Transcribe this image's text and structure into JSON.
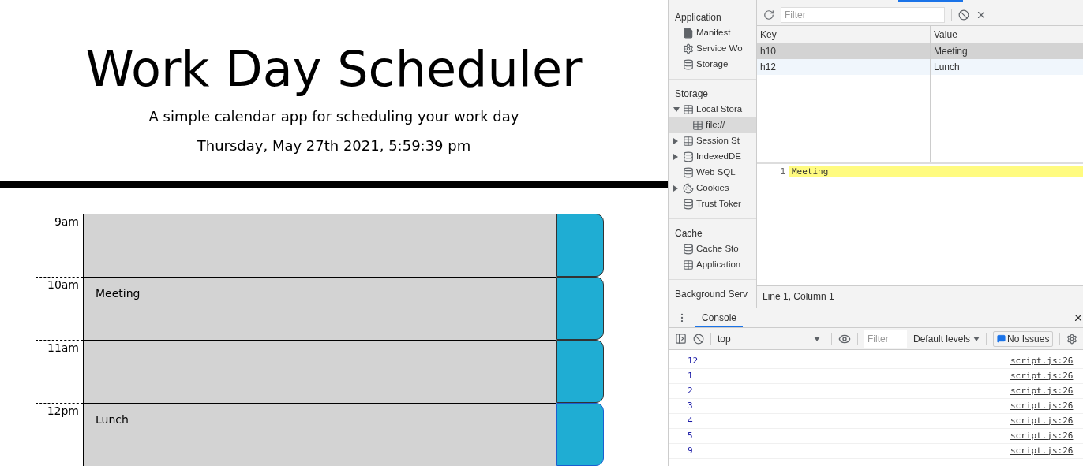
{
  "app": {
    "title": "Work Day Scheduler",
    "subtitle": "A simple calendar app for scheduling your work day",
    "date": "Thursday, May 27th 2021, 5:59:39 pm",
    "rows": [
      {
        "hour": "9am",
        "text": "",
        "focused": false
      },
      {
        "hour": "10am",
        "text": "Meeting",
        "focused": false
      },
      {
        "hour": "11am",
        "text": "",
        "focused": false
      },
      {
        "hour": "12pm",
        "text": "Lunch",
        "focused": true
      }
    ]
  },
  "devtools": {
    "sidebar": [
      {
        "heading": "Application",
        "items": [
          {
            "label": "Manifest",
            "kind": "file",
            "selected": false
          },
          {
            "label": "Service Wo",
            "kind": "gear",
            "selected": false
          },
          {
            "label": "Storage",
            "kind": "db",
            "selected": false
          }
        ]
      },
      {
        "heading": "Storage",
        "items": [
          {
            "label": "Local Stora",
            "kind": "grid",
            "selected": false,
            "expanded": true,
            "children": [
              {
                "label": "file://",
                "kind": "grid",
                "selected": true
              }
            ]
          },
          {
            "label": "Session St",
            "kind": "grid",
            "selected": false,
            "expanded": false
          },
          {
            "label": "IndexedDE",
            "kind": "db",
            "selected": false,
            "expanded": false
          },
          {
            "label": "Web SQL",
            "kind": "db",
            "selected": false
          },
          {
            "label": "Cookies",
            "kind": "cookie",
            "selected": false,
            "expanded": false
          },
          {
            "label": "Trust Toker",
            "kind": "db",
            "selected": false
          }
        ]
      },
      {
        "heading": "Cache",
        "items": [
          {
            "label": "Cache Sto",
            "kind": "db",
            "selected": false
          },
          {
            "label": "Application",
            "kind": "grid",
            "selected": false
          }
        ]
      },
      {
        "heading": "Background Serv"
      }
    ],
    "filter": {
      "placeholder": "Filter"
    },
    "table": {
      "columns": [
        "Key",
        "Value"
      ],
      "rows": [
        {
          "cells": [
            "h10",
            "Meeting"
          ],
          "selected": true
        },
        {
          "cells": [
            "h12",
            "Lunch"
          ],
          "selected": false
        }
      ]
    },
    "editor": {
      "lines": [
        {
          "number": "1",
          "text": "Meeting",
          "highlighted": true
        }
      ]
    },
    "status_bar": "Line 1, Column 1",
    "console": {
      "tab": "Console",
      "context": "top",
      "filter_placeholder": "Filter",
      "levels": "Default levels",
      "issues": "No Issues",
      "logs": [
        {
          "value": "12",
          "source": "script.js:26"
        },
        {
          "value": "1",
          "source": "script.js:26"
        },
        {
          "value": "2",
          "source": "script.js:26"
        },
        {
          "value": "3",
          "source": "script.js:26"
        },
        {
          "value": "4",
          "source": "script.js:26"
        },
        {
          "value": "5",
          "source": "script.js:26"
        },
        {
          "value": "9",
          "source": "script.js:26"
        }
      ]
    }
  }
}
